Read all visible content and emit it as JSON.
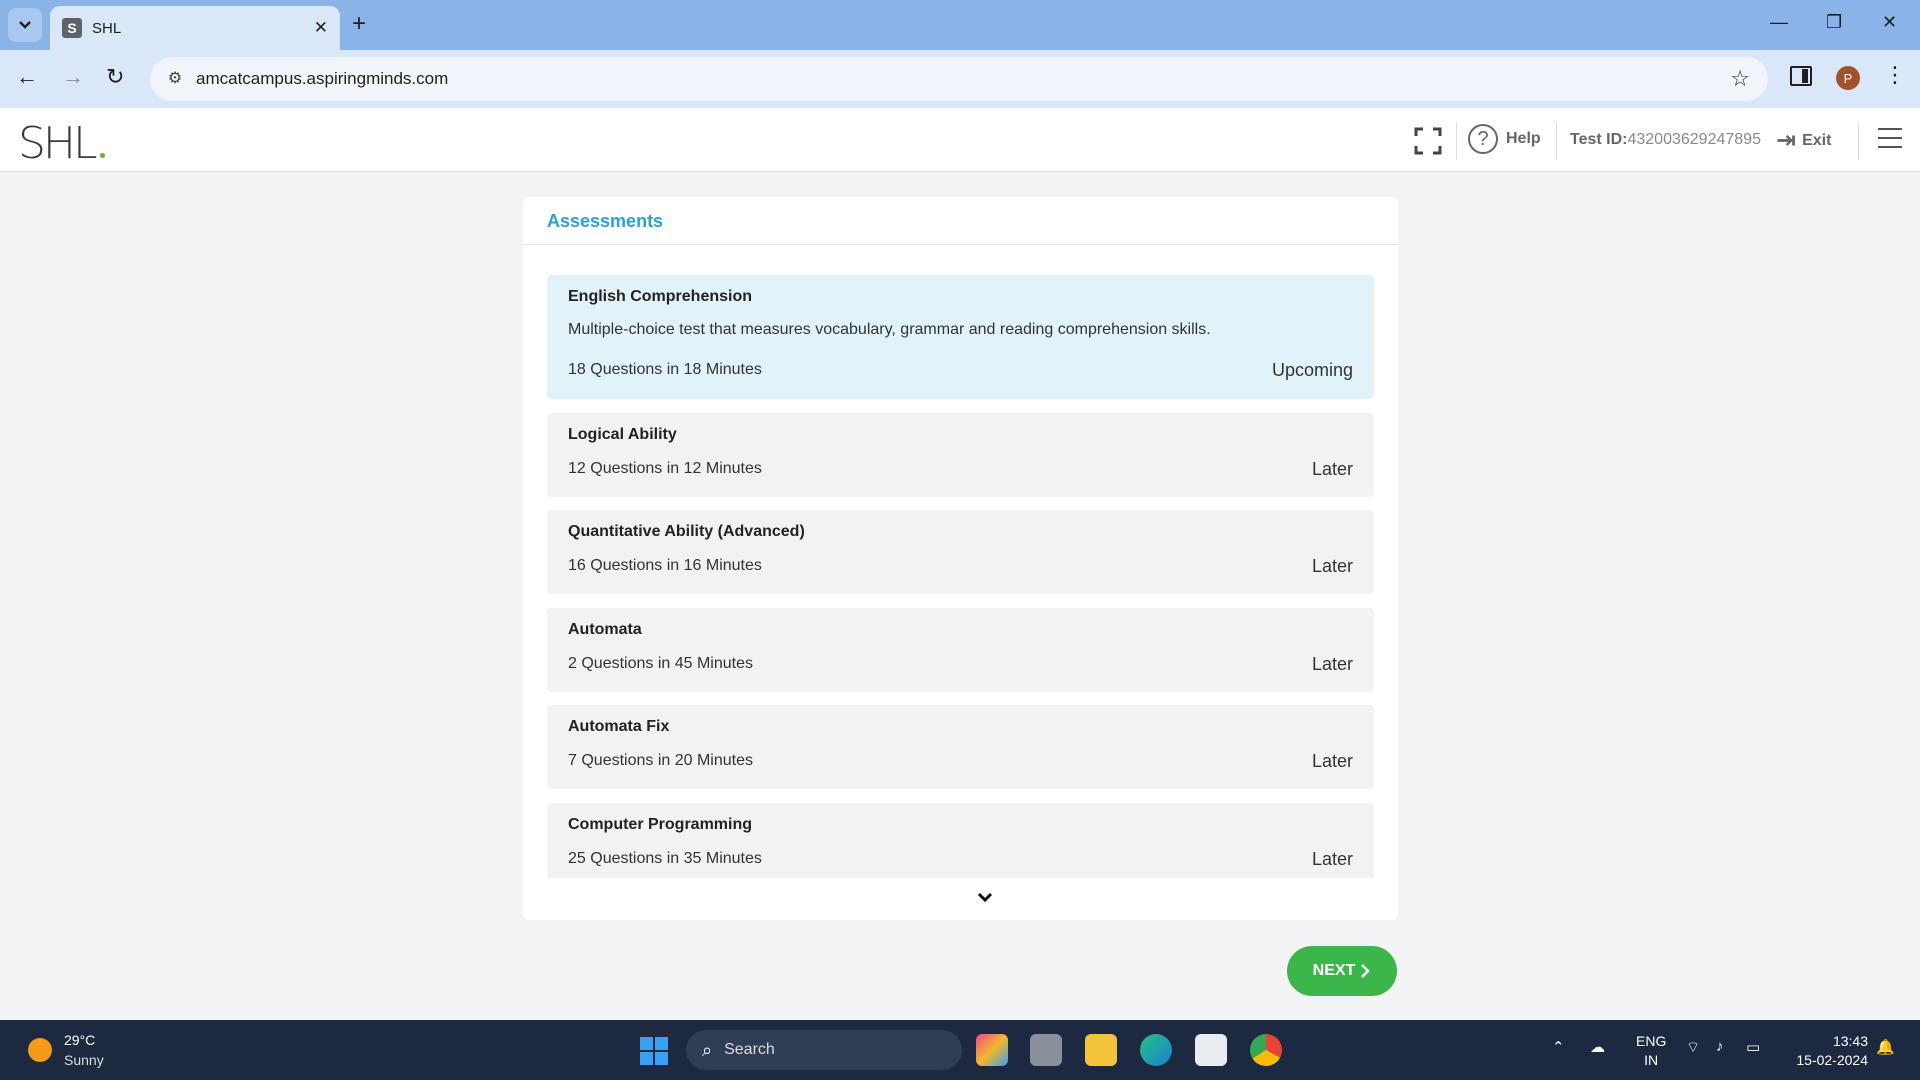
{
  "browser": {
    "tab_title": "SHL",
    "tab_favicon": "S",
    "url": "amcatcampus.aspiringminds.com",
    "profile_initial": "P"
  },
  "header": {
    "logo": "SHL",
    "help_label": "Help",
    "test_id_label": "Test ID:",
    "test_id_value": "432003629247895",
    "exit_label": "Exit"
  },
  "panel": {
    "title": "Assessments",
    "items": [
      {
        "name": "English Comprehension",
        "description": "Multiple-choice test that measures vocabulary, grammar and reading comprehension skills.",
        "meta": "18 Questions in 18 Minutes",
        "status": "Upcoming"
      },
      {
        "name": "Logical Ability",
        "meta": "12 Questions in 12 Minutes",
        "status": "Later"
      },
      {
        "name": "Quantitative Ability (Advanced)",
        "meta": "16 Questions in 16 Minutes",
        "status": "Later"
      },
      {
        "name": "Automata",
        "meta": "2 Questions in 45 Minutes",
        "status": "Later"
      },
      {
        "name": "Automata Fix",
        "meta": "7 Questions in 20 Minutes",
        "status": "Later"
      },
      {
        "name": "Computer Programming",
        "meta": "25 Questions in 35 Minutes",
        "status": "Later"
      }
    ]
  },
  "next_button": "NEXT",
  "taskbar": {
    "weather_temp": "29°C",
    "weather_desc": "Sunny",
    "search_placeholder": "Search",
    "lang_top": "ENG",
    "lang_bottom": "IN",
    "time": "13:43",
    "date": "15-02-2024"
  },
  "colors": {
    "accent": "#2ca1d3",
    "next_button": "#3cb64a",
    "active_card": "#e1f3f9"
  }
}
